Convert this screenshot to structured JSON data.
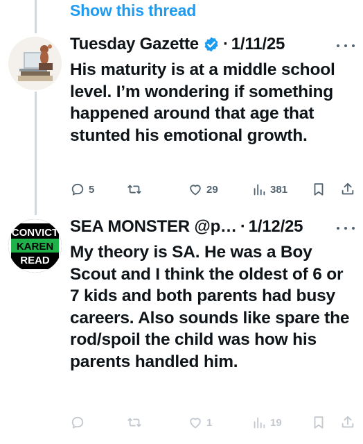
{
  "thread": {
    "show_label": "Show this thread"
  },
  "tweets": [
    {
      "name": "Tuesday Gazette",
      "separator": "·",
      "date": "1/11/25",
      "text": "His maturity is at a middle school level. I’m wondering if something happened around that age that stunted his emotional growth.",
      "replies": "5",
      "retweets": "",
      "likes": "29",
      "views": "381"
    },
    {
      "name": "SEA MONSTER @p…",
      "separator": "·",
      "date": "1/12/25",
      "avatar_lines": [
        "CONVICT",
        "KAREN",
        "READ"
      ],
      "text": "My theory is SA. He was a Boy Scout and I think the oldest of 6 or 7 kids and both parents had busy careers. Also sounds like spare the rod/spoil the child was how his parents handled him.",
      "replies": "",
      "retweets": "",
      "likes": "1",
      "views": "19"
    }
  ],
  "colors": {
    "accent": "#1d9bf0",
    "muted": "#536471",
    "thread_line": "#cfd9de",
    "avatar_green": "#1fb14a"
  },
  "icons": [
    "reply-icon",
    "retweet-icon",
    "like-icon",
    "views-icon",
    "bookmark-icon",
    "share-icon",
    "verified-icon",
    "more-icon"
  ]
}
